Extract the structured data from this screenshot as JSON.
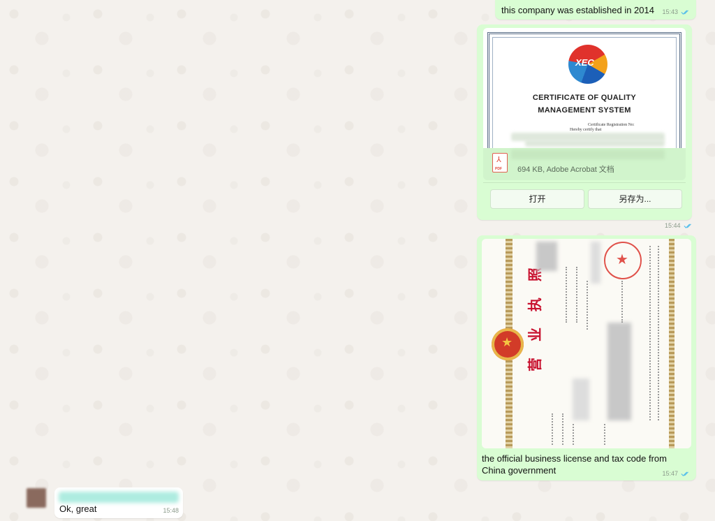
{
  "messages": {
    "m1": {
      "text": "this company was established in 2014",
      "time": "15:43"
    },
    "m2": {
      "doc": {
        "cert_title_1": "CERTIFICATE OF QUALITY",
        "cert_title_2": "MANAGEMENT SYSTEM",
        "cert_logo_text": "XEC",
        "cert_reg_label": "Certificate Registration No:",
        "cert_hereby": "Hereby certify that",
        "size_label": "694 KB, Adobe Acrobat 文档",
        "pdf_icon_label": "PDF"
      },
      "open_label": "打开",
      "save_as_label": "另存为...",
      "time": "15:44"
    },
    "m3": {
      "image_title": "营 业 执 照",
      "caption": "the official business license and tax code from China government",
      "time": "15:47"
    },
    "m4": {
      "text": "Ok, great",
      "time": "15:48"
    }
  },
  "colors": {
    "outgoing_bubble": "#d9fdd3",
    "incoming_bubble": "#ffffff",
    "read_tick": "#53bdeb"
  },
  "icons": [
    "read-receipt-icon",
    "pdf-icon"
  ]
}
